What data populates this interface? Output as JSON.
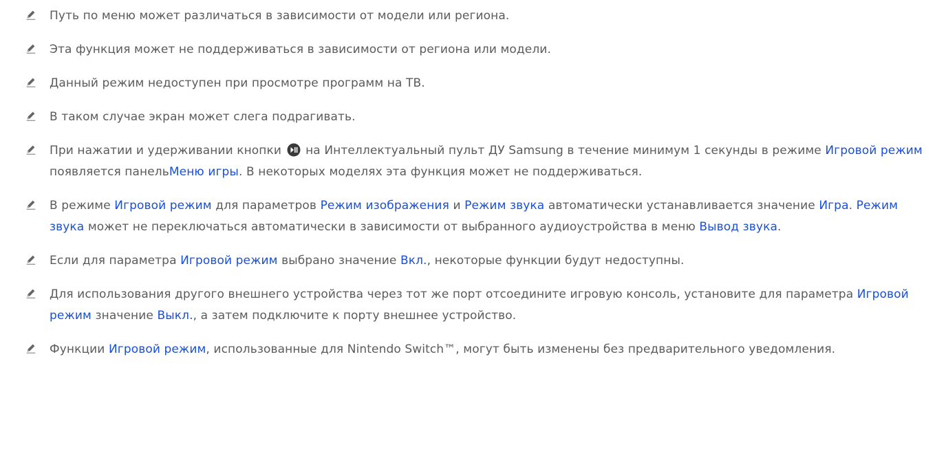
{
  "icons": {
    "note": "pencil-icon",
    "play_pause": "play-pause-icon"
  },
  "colors": {
    "text": "#5b5b5b",
    "keyword": "#1a4fd6",
    "icon": "#555555"
  },
  "notes": [
    {
      "parts": [
        "Путь по меню может различаться в зависимости от модели или региона."
      ]
    },
    {
      "parts": [
        "Эта функция может не поддерживаться в зависимости от региона или модели."
      ]
    },
    {
      "parts": [
        "Данный режим недоступен при просмотре программ на ТВ."
      ]
    },
    {
      "parts": [
        "В таком случае экран может слега подрагивать."
      ]
    },
    {
      "parts": [
        "При нажатии и удерживании кнопки",
        "на Интеллектуальный пульт ДУ Samsung в течение минимум 1 секунды в режиме",
        "Игровой режим",
        "появляется панель",
        "Меню игры",
        ". В некоторых моделях эта функция может не поддерживаться."
      ]
    },
    {
      "parts": [
        "В режиме",
        "Игровой режим",
        "для параметров",
        "Режим изображения",
        "и",
        "Режим звука",
        "автоматически устанавливается значение",
        "Игра",
        ".",
        "Режим звука",
        "может не переключаться автоматически в зависимости от выбранного аудиоустройства в меню",
        "Вывод звука",
        "."
      ]
    },
    {
      "parts": [
        "Если для параметра",
        "Игровой режим",
        "выбрано значение",
        "Вкл.",
        ", некоторые функции будут недоступны."
      ]
    },
    {
      "parts": [
        "Для использования другого внешнего устройства через тот же порт отсоедините игровую консоль, установите для параметра",
        "Игровой режим",
        "значение",
        "Выкл.",
        ", а затем подключите к порту внешнее устройство."
      ]
    },
    {
      "parts": [
        "Функции",
        "Игровой режим",
        ", использованные для Nintendo Switch™, могут быть изменены без предварительного уведомления."
      ]
    }
  ]
}
